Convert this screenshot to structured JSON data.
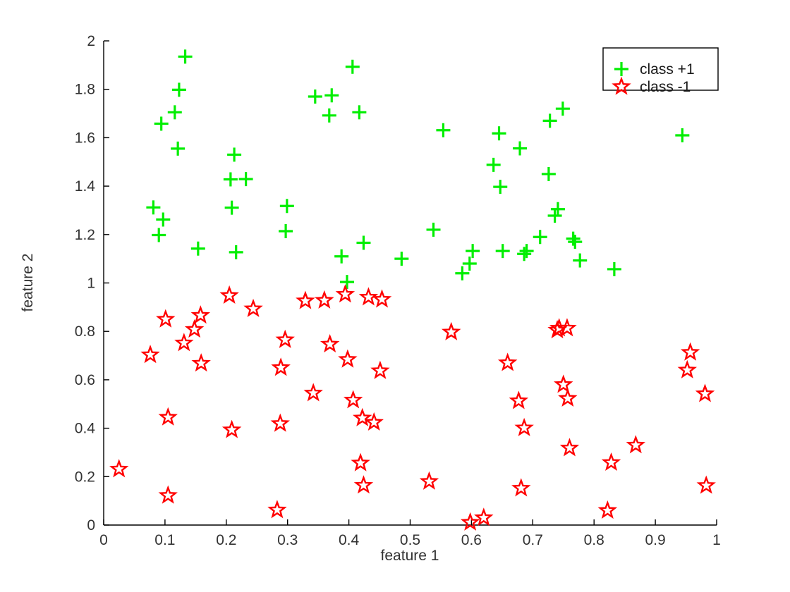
{
  "chart_data": {
    "type": "scatter",
    "title": "",
    "xlabel": "feature 1",
    "ylabel": "feature 2",
    "xlim": [
      0,
      1
    ],
    "ylim": [
      0,
      2
    ],
    "xticks": [
      "0",
      "0.1",
      "0.2",
      "0.3",
      "0.4",
      "0.5",
      "0.6",
      "0.7",
      "0.8",
      "0.9",
      "1"
    ],
    "xtick_values": [
      0,
      0.1,
      0.2,
      0.3,
      0.4,
      0.5,
      0.6,
      0.7,
      0.8,
      0.9,
      1
    ],
    "yticks": [
      "0",
      "0.2",
      "0.4",
      "0.6",
      "0.8",
      "1",
      "1.2",
      "1.4",
      "1.6",
      "1.8",
      "2"
    ],
    "ytick_values": [
      0,
      0.2,
      0.4,
      0.6,
      0.8,
      1,
      1.2,
      1.4,
      1.6,
      1.8,
      2
    ],
    "grid": false,
    "legend_position": "top-right",
    "series": [
      {
        "name": "class +1",
        "marker": "plus",
        "color": "#00EE00",
        "points": [
          [
            0.133,
            1.935
          ],
          [
            0.123,
            1.798
          ],
          [
            0.116,
            1.705
          ],
          [
            0.094,
            1.658
          ],
          [
            0.121,
            1.555
          ],
          [
            0.081,
            1.312
          ],
          [
            0.097,
            1.262
          ],
          [
            0.09,
            1.198
          ],
          [
            0.154,
            1.142
          ],
          [
            0.213,
            1.53
          ],
          [
            0.207,
            1.428
          ],
          [
            0.232,
            1.429
          ],
          [
            0.209,
            1.311
          ],
          [
            0.216,
            1.127
          ],
          [
            0.299,
            1.318
          ],
          [
            0.297,
            1.214
          ],
          [
            0.345,
            1.77
          ],
          [
            0.372,
            1.775
          ],
          [
            0.368,
            1.692
          ],
          [
            0.406,
            1.893
          ],
          [
            0.417,
            1.705
          ],
          [
            0.388,
            1.11
          ],
          [
            0.397,
            1.004
          ],
          [
            0.424,
            1.166
          ],
          [
            0.486,
            1.1
          ],
          [
            0.554,
            1.631
          ],
          [
            0.538,
            1.22
          ],
          [
            0.585,
            1.04
          ],
          [
            0.597,
            1.08
          ],
          [
            0.602,
            1.132
          ],
          [
            0.645,
            1.618
          ],
          [
            0.647,
            1.397
          ],
          [
            0.636,
            1.488
          ],
          [
            0.651,
            1.132
          ],
          [
            0.679,
            1.556
          ],
          [
            0.686,
            1.12
          ],
          [
            0.69,
            1.132
          ],
          [
            0.712,
            1.19
          ],
          [
            0.728,
            1.67
          ],
          [
            0.749,
            1.72
          ],
          [
            0.726,
            1.45
          ],
          [
            0.741,
            1.305
          ],
          [
            0.736,
            1.278
          ],
          [
            0.766,
            1.183
          ],
          [
            0.769,
            1.17
          ],
          [
            0.777,
            1.093
          ],
          [
            0.833,
            1.057
          ],
          [
            0.944,
            1.61
          ]
        ]
      },
      {
        "name": "class -1",
        "marker": "star",
        "color": "#FF0000",
        "points": [
          [
            0.025,
            0.231
          ],
          [
            0.076,
            0.703
          ],
          [
            0.101,
            0.85
          ],
          [
            0.105,
            0.445
          ],
          [
            0.105,
            0.122
          ],
          [
            0.131,
            0.752
          ],
          [
            0.148,
            0.808
          ],
          [
            0.158,
            0.866
          ],
          [
            0.159,
            0.668
          ],
          [
            0.205,
            0.948
          ],
          [
            0.209,
            0.393
          ],
          [
            0.244,
            0.893
          ],
          [
            0.283,
            0.062
          ],
          [
            0.288,
            0.419
          ],
          [
            0.289,
            0.65
          ],
          [
            0.296,
            0.765
          ],
          [
            0.329,
            0.926
          ],
          [
            0.342,
            0.545
          ],
          [
            0.36,
            0.928
          ],
          [
            0.369,
            0.747
          ],
          [
            0.394,
            0.953
          ],
          [
            0.398,
            0.684
          ],
          [
            0.407,
            0.516
          ],
          [
            0.419,
            0.256
          ],
          [
            0.422,
            0.442
          ],
          [
            0.424,
            0.164
          ],
          [
            0.432,
            0.941
          ],
          [
            0.441,
            0.424
          ],
          [
            0.454,
            0.932
          ],
          [
            0.451,
            0.637
          ],
          [
            0.531,
            0.18
          ],
          [
            0.567,
            0.797
          ],
          [
            0.598,
            0.011
          ],
          [
            0.62,
            0.03
          ],
          [
            0.659,
            0.67
          ],
          [
            0.677,
            0.513
          ],
          [
            0.681,
            0.152
          ],
          [
            0.686,
            0.401
          ],
          [
            0.74,
            0.805
          ],
          [
            0.743,
            0.813
          ],
          [
            0.75,
            0.58
          ],
          [
            0.756,
            0.813
          ],
          [
            0.757,
            0.523
          ],
          [
            0.76,
            0.318
          ],
          [
            0.822,
            0.06
          ],
          [
            0.828,
            0.258
          ],
          [
            0.868,
            0.33
          ],
          [
            0.952,
            0.64
          ],
          [
            0.957,
            0.713
          ],
          [
            0.981,
            0.542
          ],
          [
            0.983,
            0.163
          ]
        ]
      }
    ]
  },
  "axes": {
    "x_title": "feature 1",
    "y_title": "feature 2"
  },
  "legend": {
    "entries": [
      {
        "label": "class +1",
        "marker": "plus-icon",
        "color": "#00EE00"
      },
      {
        "label": "class -1",
        "marker": "star-icon",
        "color": "#FF0000"
      }
    ]
  }
}
